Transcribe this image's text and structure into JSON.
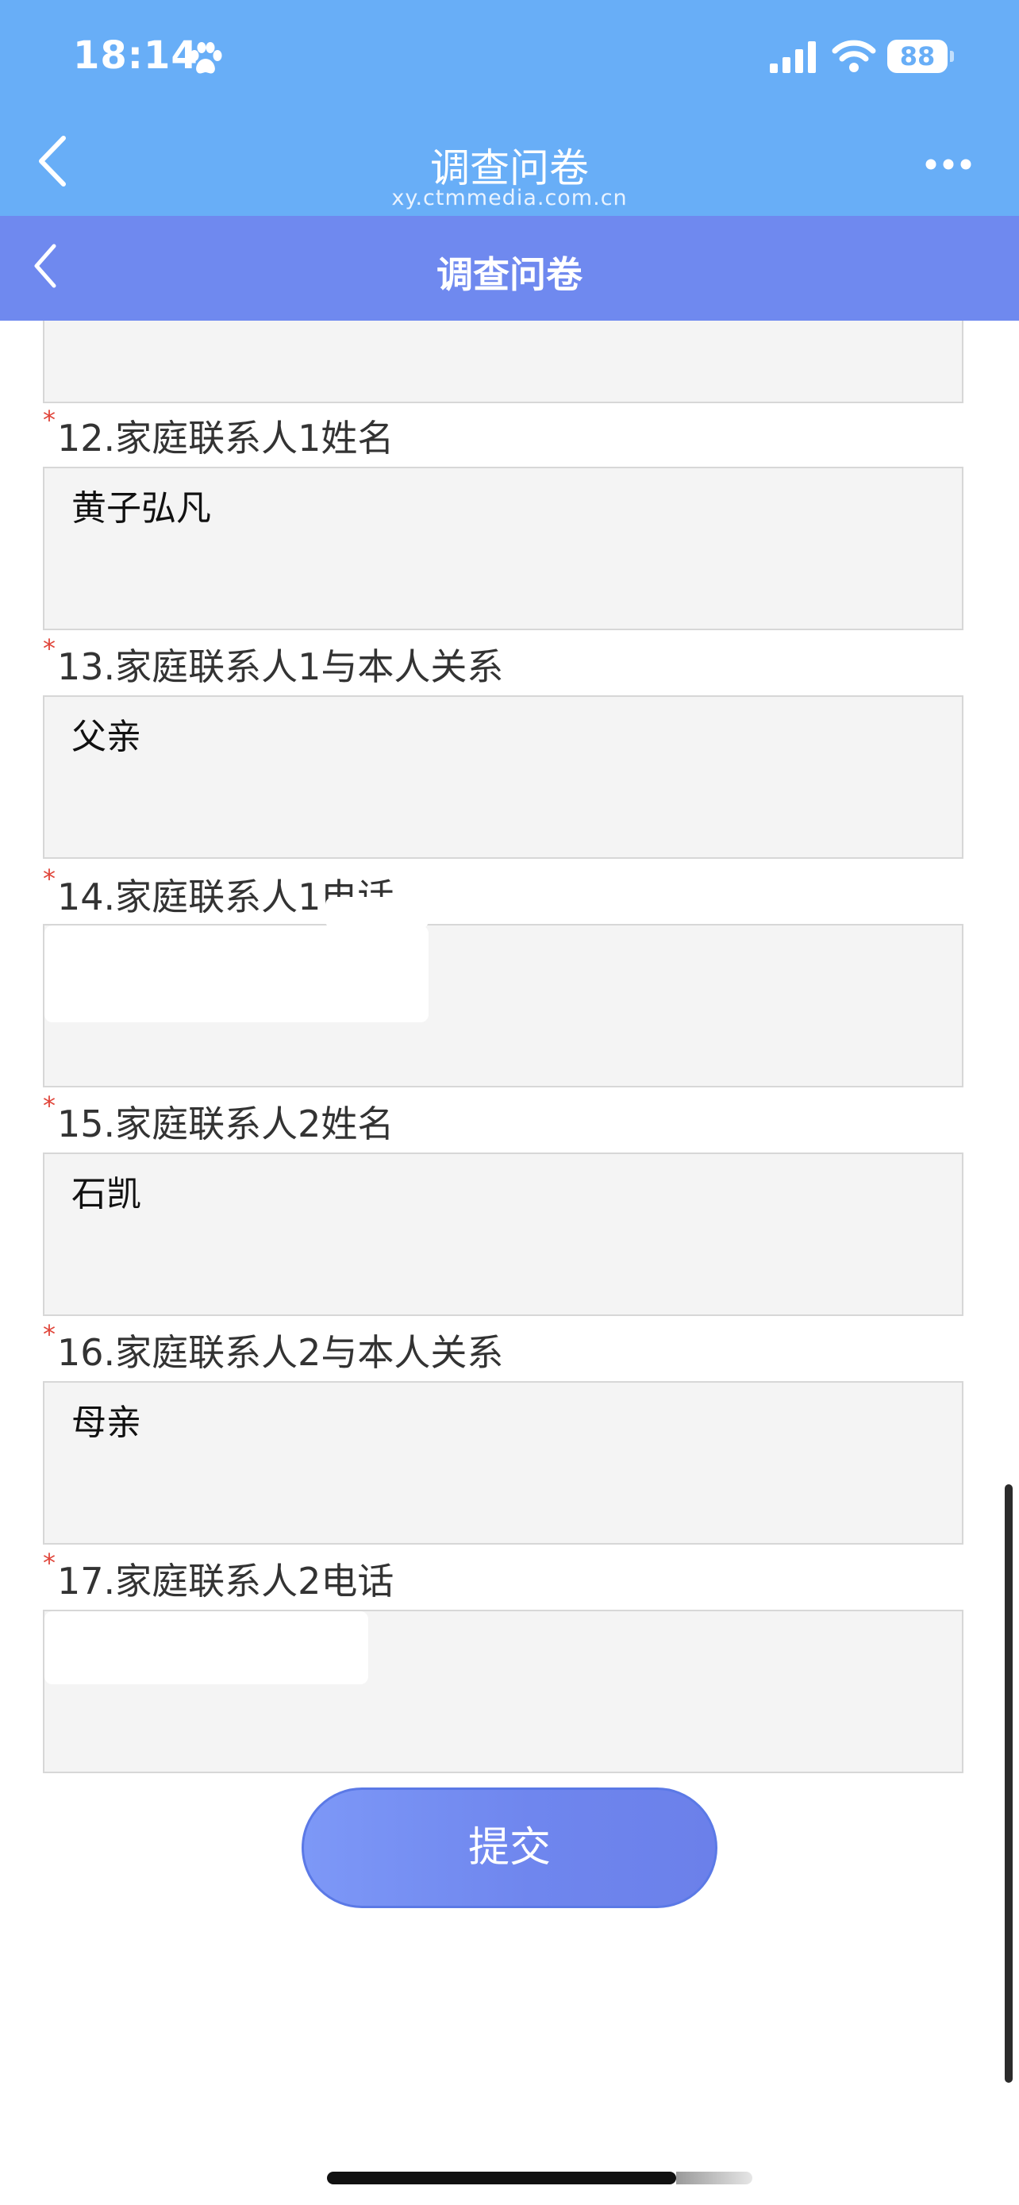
{
  "status_bar": {
    "time": "18:14",
    "battery": "88",
    "icons": [
      "paw-icon",
      "signal-icon",
      "wifi-icon",
      "battery-icon"
    ]
  },
  "browser_bar": {
    "title": "调查问卷",
    "url": "xy.ctmmedia.com.cn",
    "icons": [
      "back-icon",
      "more-icon"
    ]
  },
  "page_nav": {
    "title": "调查问卷",
    "icons": [
      "back-icon"
    ]
  },
  "form": {
    "required_mark": "*",
    "questions": [
      {
        "label": "12.家庭联系人1姓名",
        "answer": "黄子弘凡"
      },
      {
        "label": "13.家庭联系人1与本人关系",
        "answer": "父亲"
      },
      {
        "label": "14.家庭联系人1电话",
        "answer": ""
      },
      {
        "label": "15.家庭联系人2姓名",
        "answer": "石凯"
      },
      {
        "label": "16.家庭联系人2与本人关系",
        "answer": "母亲"
      },
      {
        "label": "17.家庭联系人2电话",
        "answer": ""
      }
    ],
    "submit_label": "提交"
  },
  "colors": {
    "browser_bar": "#68aef7",
    "page_nav": "#6f89ef",
    "required": "#e0453a",
    "submit": "#6f86ee",
    "answer_box": "#f4f4f4"
  }
}
